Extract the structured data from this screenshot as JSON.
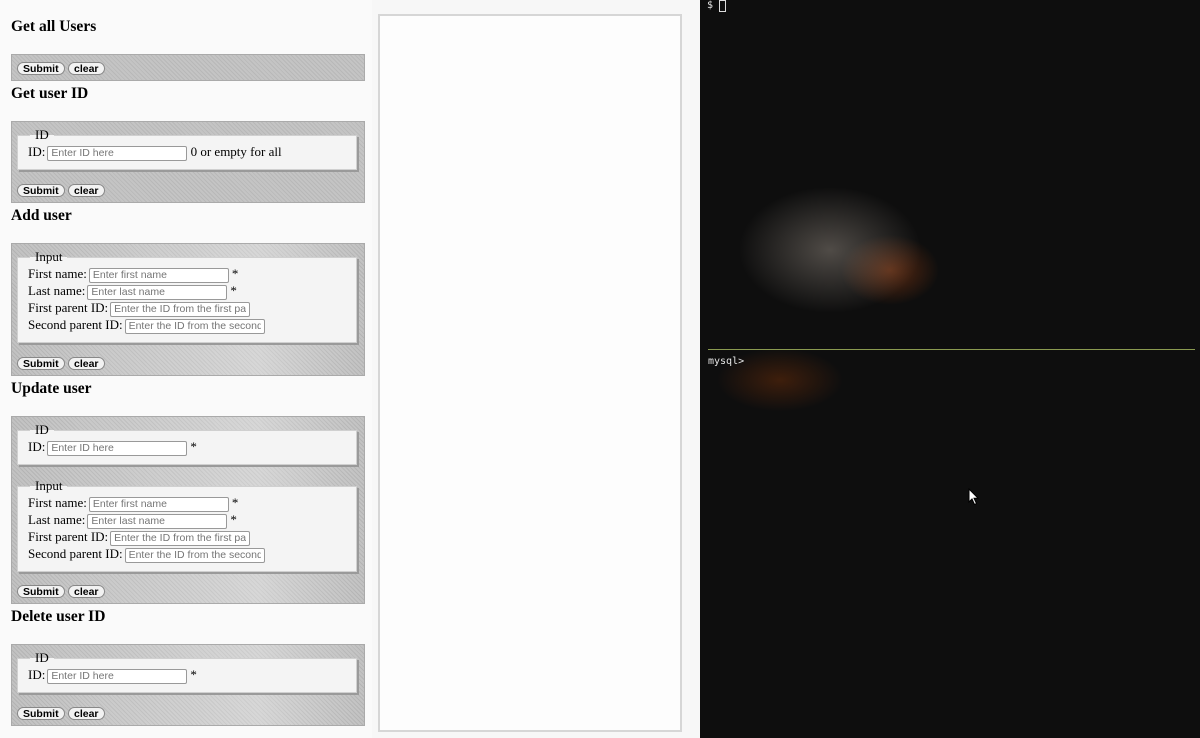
{
  "sections": {
    "get_all": {
      "title": "Get all Users",
      "submit": "Submit",
      "clear": "clear"
    },
    "get_id": {
      "title": "Get user ID",
      "legend": "ID",
      "id_label": "ID:",
      "id_placeholder": "Enter ID here",
      "id_hint": "0 or empty for all",
      "submit": "Submit",
      "clear": "clear"
    },
    "add": {
      "title": "Add user",
      "legend": "Input",
      "first_label": "First name:",
      "first_placeholder": "Enter first name",
      "last_label": "Last name:",
      "last_placeholder": "Enter last name",
      "parent1_label": "First parent ID:",
      "parent1_placeholder": "Enter the ID from the first parent",
      "parent2_label": "Second parent ID:",
      "parent2_placeholder": "Enter the ID from the second parent",
      "required": "*",
      "submit": "Submit",
      "clear": "clear"
    },
    "update": {
      "title": "Update user",
      "id_legend": "ID",
      "id_label": "ID:",
      "id_placeholder": "Enter ID here",
      "input_legend": "Input",
      "first_label": "First name:",
      "first_placeholder": "Enter first name",
      "last_label": "Last name:",
      "last_placeholder": "Enter last name",
      "parent1_label": "First parent ID:",
      "parent1_placeholder": "Enter the ID from the first parent",
      "parent2_label": "Second parent ID:",
      "parent2_placeholder": "Enter the ID from the second parent",
      "required": "*",
      "submit": "Submit",
      "clear": "clear"
    },
    "delete": {
      "title": "Delete user ID",
      "legend": "ID",
      "id_label": "ID:",
      "id_placeholder": "Enter ID here",
      "required": "*",
      "submit": "Submit",
      "clear": "clear"
    }
  },
  "terminal": {
    "top_prompt": "$",
    "bottom_prompt": "mysql>"
  },
  "icons": {
    "cursor": "mouse-pointer-icon"
  },
  "colors": {
    "divider": "#8a9a50",
    "terminal_bg": "#0e0e0e"
  }
}
